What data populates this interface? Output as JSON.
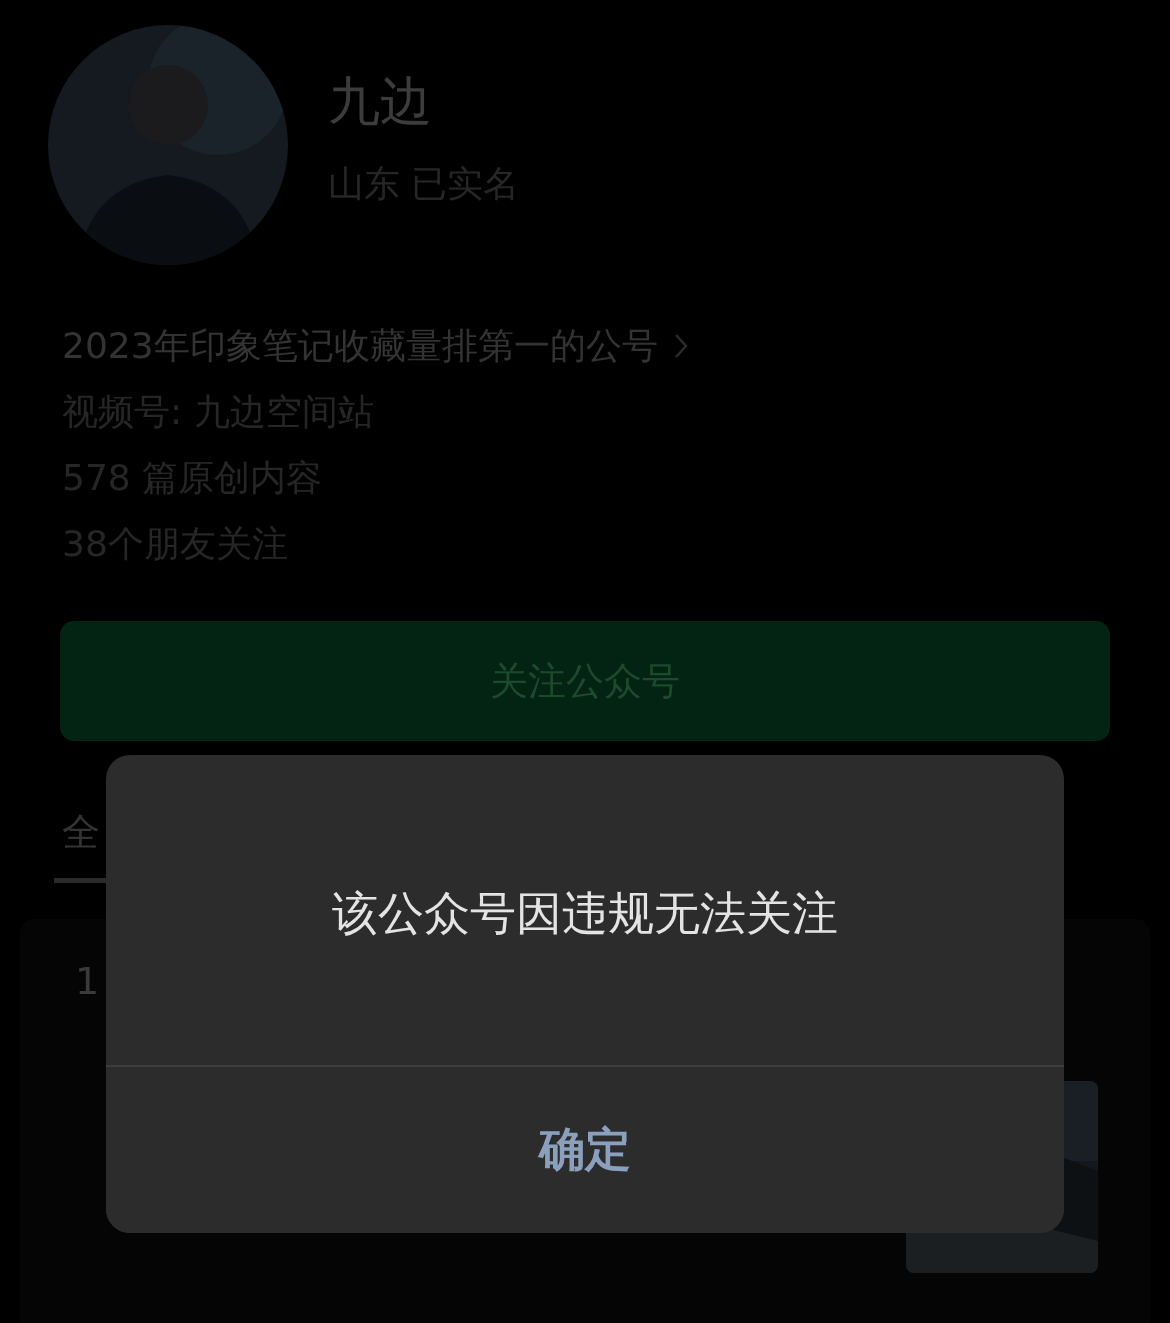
{
  "profile": {
    "name": "九边",
    "meta": "山东 已实名"
  },
  "info_lines": [
    {
      "text": "2023年印象笔记收藏量排第一的公号",
      "link": true
    },
    {
      "text": "视频号: 九边空间站",
      "link": false
    },
    {
      "text": "578 篇原创内容",
      "link": false
    },
    {
      "text": "38个朋友关注",
      "link": false
    }
  ],
  "follow_button": "关注公众号",
  "tabs": [
    {
      "label": "全",
      "selected": true
    }
  ],
  "article": {
    "date": "1"
  },
  "dialog": {
    "message": "该公众号因违规无法关注",
    "button": "确定"
  }
}
